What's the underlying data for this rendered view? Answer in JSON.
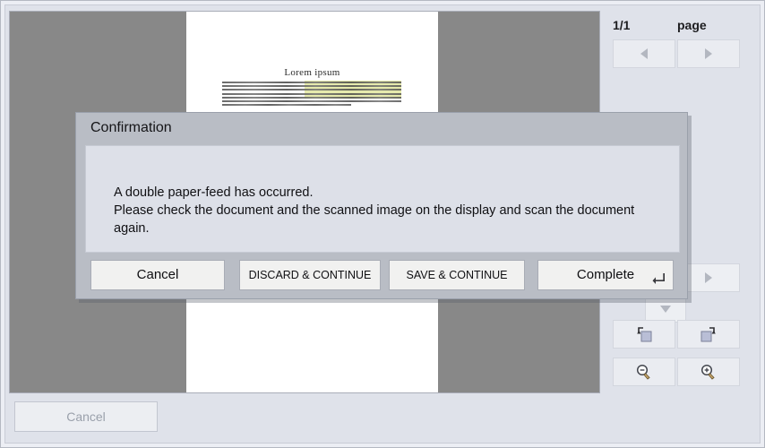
{
  "window": {
    "preview": {
      "document_heading": "Lorem ipsum",
      "body_line_count": 7,
      "highlight_color": "#c4ce3c",
      "canvas_color": "#888888",
      "sheet_color": "#ffffff"
    },
    "bottom_bar": {
      "cancel_label": "Cancel",
      "cancel_disabled": true
    }
  },
  "side_panel": {
    "page_counter": "1/1",
    "page_label": "page",
    "buttons": [
      {
        "name": "previous-page-button",
        "icon": "arrow-left-icon"
      },
      {
        "name": "next-page-button",
        "icon": "arrow-right-icon"
      },
      {
        "name": "scroll-right-button",
        "icon": "arrow-right-icon"
      },
      {
        "name": "scroll-down-button",
        "icon": "arrow-down-icon"
      },
      {
        "name": "rotate-left-button",
        "icon": "rotate-left-icon"
      },
      {
        "name": "rotate-right-button",
        "icon": "rotate-right-icon"
      },
      {
        "name": "zoom-out-button",
        "icon": "magnifier-minus-icon"
      },
      {
        "name": "zoom-in-button",
        "icon": "magnifier-plus-icon"
      }
    ]
  },
  "dialog": {
    "title": "Confirmation",
    "message": "A double paper-feed has occurred.\nPlease check the document and the scanned image on the display and scan the document again.",
    "buttons": {
      "cancel": "Cancel",
      "discard_continue": "DISCARD & CONTINUE",
      "save_continue": "SAVE & CONTINUE",
      "complete": "Complete"
    },
    "complete_has_enter_key_glyph": true,
    "title_bar_color": "#b9bdc5",
    "body_color": "#dde0e8"
  }
}
